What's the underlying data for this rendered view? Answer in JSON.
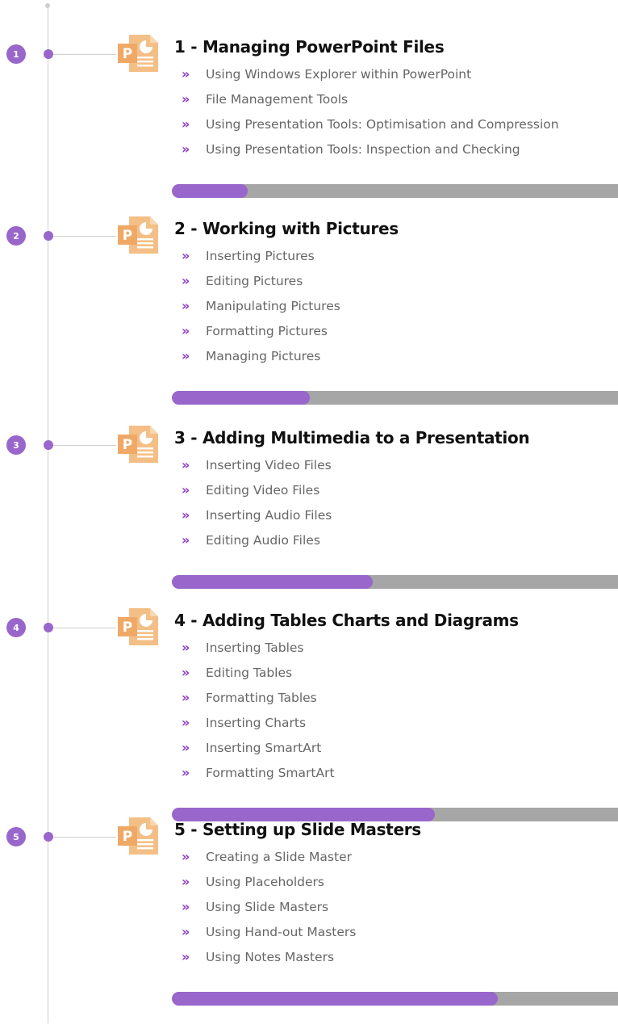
{
  "colors": {
    "accent": "#9966cc",
    "chevron": "#8a3dc4",
    "track": "#a6a6a6",
    "icon": "#f4bf86"
  },
  "modules": [
    {
      "number": "1",
      "title": "1 - Managing PowerPoint Files",
      "icon": "powerpoint-file-icon",
      "progress": 0.17,
      "topics": [
        "Using Windows Explorer within PowerPoint",
        "File Management Tools",
        "Using Presentation Tools: Optimisation and Compression",
        "Using Presentation Tools: Inspection and Checking"
      ]
    },
    {
      "number": "2",
      "title": "2 - Working with Pictures",
      "icon": "powerpoint-file-icon",
      "progress": 0.31,
      "topics": [
        "Inserting Pictures",
        "Editing Pictures",
        "Manipulating Pictures",
        "Formatting Pictures",
        "Managing Pictures"
      ]
    },
    {
      "number": "3",
      "title": "3 - Adding Multimedia to a Presentation",
      "icon": "powerpoint-file-icon",
      "progress": 0.45,
      "topics": [
        "Inserting Video Files",
        "Editing Video Files",
        "Inserting Audio Files",
        "Editing Audio Files"
      ]
    },
    {
      "number": "4",
      "title": "4 - Adding Tables Charts and Diagrams",
      "icon": "powerpoint-file-icon",
      "progress": 0.59,
      "topics": [
        "Inserting Tables",
        "Editing Tables",
        "Formatting Tables",
        "Inserting Charts",
        "Inserting SmartArt",
        "Formatting SmartArt"
      ]
    },
    {
      "number": "5",
      "title": "5 - Setting up Slide Masters",
      "icon": "powerpoint-file-icon",
      "progress": 0.73,
      "topics": [
        "Creating a Slide Master",
        "Using Placeholders",
        "Using Slide Masters",
        "Using Hand-out Masters",
        "Using Notes Masters"
      ]
    }
  ]
}
